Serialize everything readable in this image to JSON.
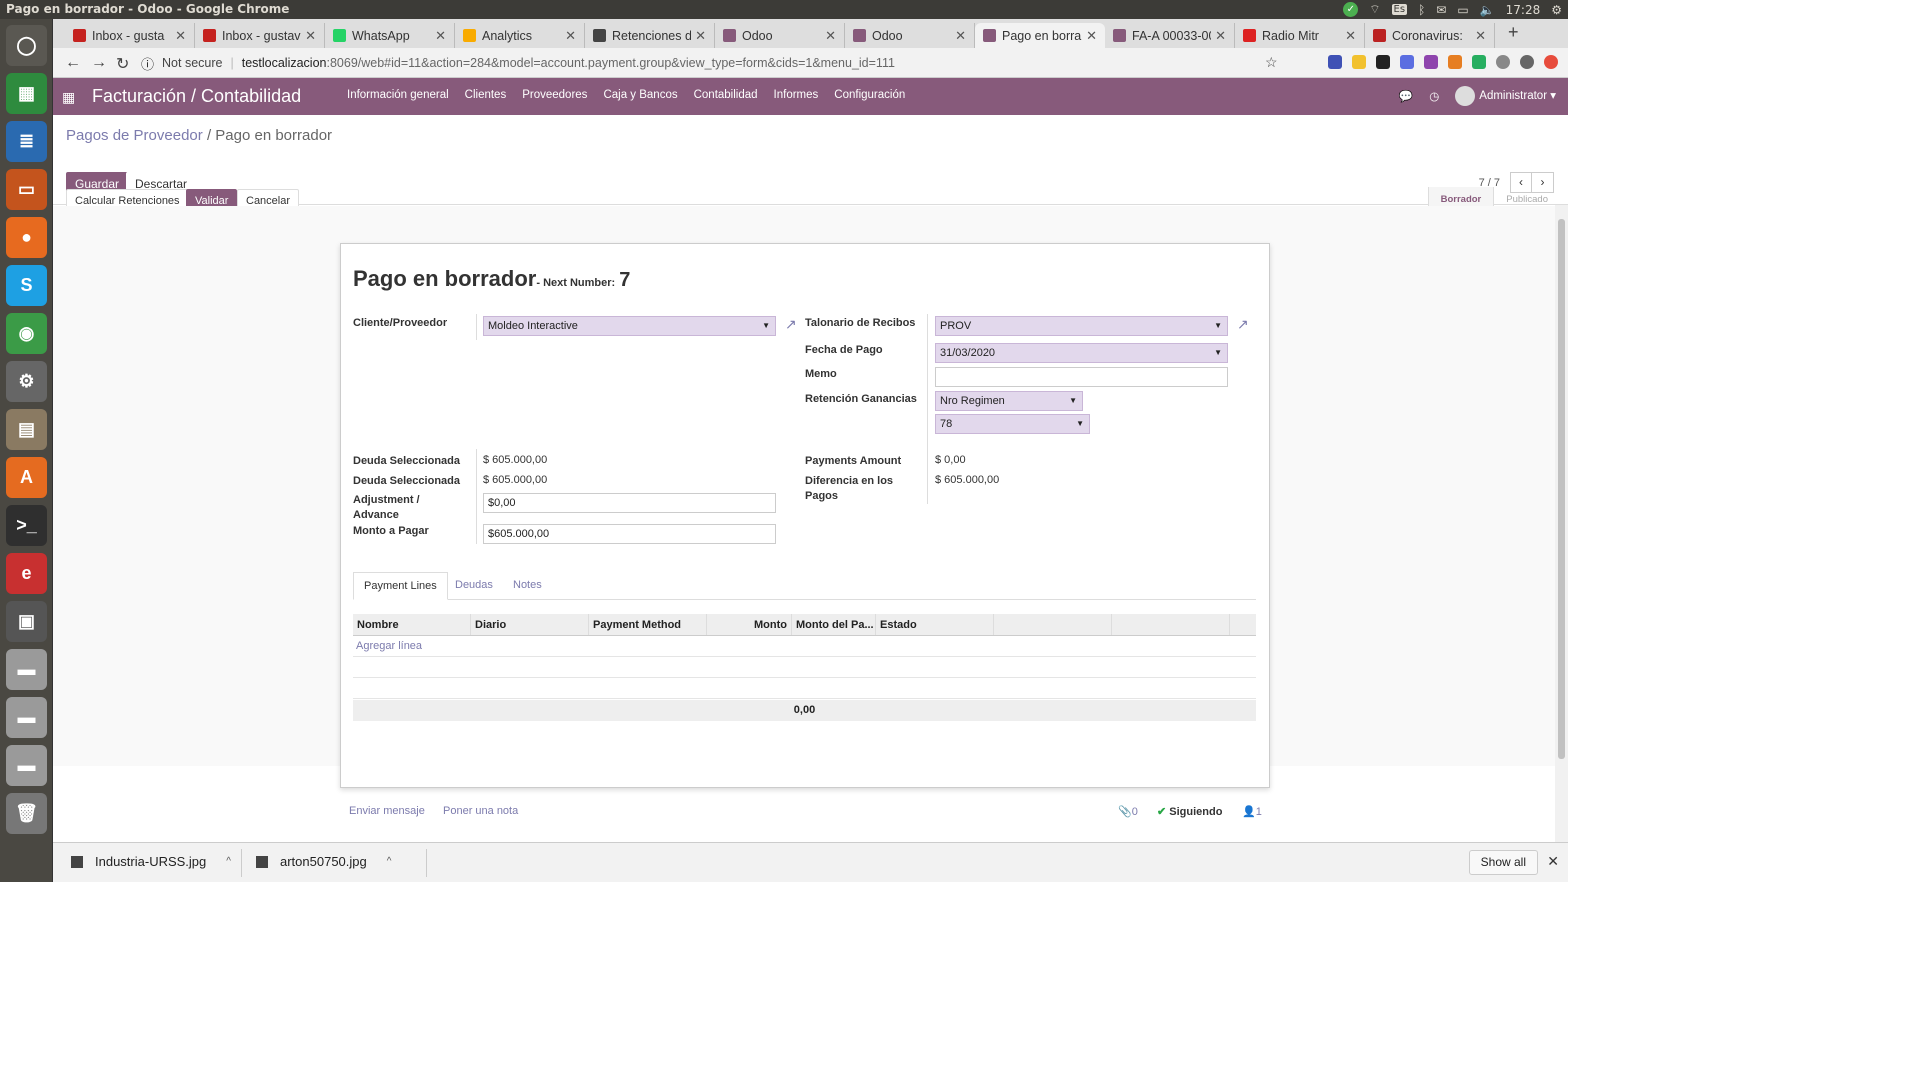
{
  "os": {
    "window_title": "Pago en borrador - Odoo - Google Chrome",
    "keyboard_layout": "Es",
    "clock": "17:28"
  },
  "launcher": {
    "items": [
      {
        "name": "ubuntu-dash-icon",
        "color": "#5a5852",
        "glyph": "◯"
      },
      {
        "name": "calc-spreadsheet-icon",
        "color": "#2e8b3e",
        "glyph": "▦"
      },
      {
        "name": "writer-document-icon",
        "color": "#2a6ab0",
        "glyph": "≣"
      },
      {
        "name": "impress-presentation-icon",
        "color": "#c4541d",
        "glyph": "▭"
      },
      {
        "name": "firefox-icon",
        "color": "#e76a1f",
        "glyph": "●"
      },
      {
        "name": "skype-icon",
        "color": "#1ea0e3",
        "glyph": "S"
      },
      {
        "name": "chrome-icon",
        "color": "#3b9b47",
        "glyph": "◉"
      },
      {
        "name": "system-settings-icon",
        "color": "#666",
        "glyph": "⚙"
      },
      {
        "name": "files-icon",
        "color": "#8a7a62",
        "glyph": "▤"
      },
      {
        "name": "software-center-icon",
        "color": "#e56b20",
        "glyph": "A"
      },
      {
        "name": "terminal-icon",
        "color": "#2f2f2f",
        "glyph": ">_"
      },
      {
        "name": "app-red-icon",
        "color": "#c83030",
        "glyph": "e"
      },
      {
        "name": "workspace-switcher-icon",
        "color": "#555",
        "glyph": "▣"
      },
      {
        "name": "disk-1-icon",
        "color": "#9a9a9a",
        "glyph": "▬"
      },
      {
        "name": "disk-2-icon",
        "color": "#9a9a9a",
        "glyph": "▬"
      },
      {
        "name": "disk-3-icon",
        "color": "#9a9a9a",
        "glyph": "▬"
      },
      {
        "name": "trash-icon",
        "color": "#777",
        "glyph": "🗑"
      }
    ]
  },
  "browser": {
    "tabs": [
      {
        "title": "Inbox - gusta",
        "color": "#c5221f"
      },
      {
        "title": "Inbox - gustav",
        "color": "#c5221f"
      },
      {
        "title": "WhatsApp",
        "color": "#25d366"
      },
      {
        "title": "Analytics",
        "color": "#f9ab00"
      },
      {
        "title": "Retenciones d",
        "color": "#444"
      },
      {
        "title": "Odoo",
        "color": "#875a7b"
      },
      {
        "title": "Odoo",
        "color": "#875a7b"
      },
      {
        "title": "Pago en borra",
        "color": "#875a7b"
      },
      {
        "title": "FA-A 00033-00",
        "color": "#875a7b"
      },
      {
        "title": "Radio Mitr",
        "color": "#d22"
      },
      {
        "title": "Coronavirus:",
        "color": "#b22"
      }
    ],
    "active_tab": 7,
    "security": "Not secure",
    "url_host": "testlocalizacion",
    "url_path": ":8069/web#id=11&action=284&model=account.payment.group&view_type=form&cids=1&menu_id=111"
  },
  "odoo": {
    "brand": "Facturación / Contabilidad",
    "menu": [
      "Información general",
      "Clientes",
      "Proveedores",
      "Caja y Bancos",
      "Contabilidad",
      "Informes",
      "Configuración"
    ],
    "user": "Administrator",
    "breadcrumb_parent": "Pagos de Proveedor",
    "breadcrumb_sep": "/",
    "breadcrumb_current": "Pago en borrador",
    "save": "Guardar",
    "discard": "Descartar",
    "pager": "7 / 7",
    "btn_calc": "Calcular Retenciones",
    "btn_validate": "Validar",
    "btn_cancel": "Cancelar",
    "status_draft": "Borrador",
    "status_posted": "Publicado"
  },
  "form": {
    "title": "Pago en borrador",
    "next_number_label": "- Next Number:",
    "next_number_value": "7",
    "partner_label": "Cliente/Proveedor",
    "partner_value": "Moldeo Interactive",
    "receiptbook_label": "Talonario de Recibos",
    "receiptbook_value": "PROV",
    "date_label": "Fecha de Pago",
    "date_value": "31/03/2020",
    "memo_label": "Memo",
    "memo_value": "",
    "ret_label": "Retención Ganancias",
    "ret_select_value": "Nro Regimen",
    "ret_number_value": "78",
    "debt_sel_label_1": "Deuda Seleccionada",
    "debt_sel_value_1": "$ 605.000,00",
    "debt_sel_label_2": "Deuda Seleccionada",
    "debt_sel_value_2": "$ 605.000,00",
    "adjust_label": "Adjustment / Advance",
    "adjust_value": "$0,00",
    "to_pay_label": "Monto a Pagar",
    "to_pay_value": "$605.000,00",
    "payments_amount_label": "Payments Amount",
    "payments_amount_value": "$ 0,00",
    "diff_label": "Diferencia en los Pagos",
    "diff_value": "$ 605.000,00",
    "tabs": [
      "Payment Lines",
      "Deudas",
      "Notes"
    ],
    "grid_headers": [
      "Nombre",
      "Diario",
      "Payment Method",
      "Monto",
      "Monto del Pa...",
      "Estado",
      "",
      ""
    ],
    "add_line": "Agregar línea",
    "total": "0,00"
  },
  "chatter": {
    "send_message": "Enviar mensaje",
    "log_note": "Poner una nota",
    "attachments": "0",
    "following": "Siguiendo",
    "followers": "1"
  },
  "downloads": {
    "files": [
      "Industria-URSS.jpg",
      "arton50750.jpg"
    ],
    "show_all": "Show all"
  },
  "colors": {
    "odoo_primary": "#875a7b",
    "link": "#7c7bad"
  }
}
